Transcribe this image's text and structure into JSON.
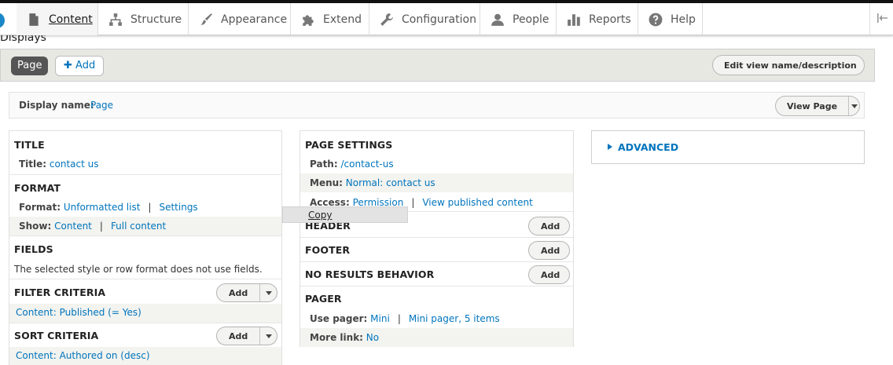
{
  "toolbar": {
    "items": [
      {
        "label": "Content",
        "icon": "file-icon",
        "active": true
      },
      {
        "label": "Structure",
        "icon": "sitemap-icon"
      },
      {
        "label": "Appearance",
        "icon": "paintbrush-icon"
      },
      {
        "label": "Extend",
        "icon": "puzzle-icon"
      },
      {
        "label": "Configuration",
        "icon": "wrench-icon"
      },
      {
        "label": "People",
        "icon": "person-icon"
      },
      {
        "label": "Reports",
        "icon": "bar-chart-icon"
      },
      {
        "label": "Help",
        "icon": "question-icon"
      }
    ]
  },
  "page": {
    "displays_title": "Displays"
  },
  "display_tabs": {
    "page_tab": "Page",
    "add_label": "Add",
    "edit_view_label": "Edit view name/description"
  },
  "display_name": {
    "label": "Display name:",
    "value": "Page",
    "view_page_label": "View Page"
  },
  "left": {
    "title_heading": "TITLE",
    "title_label": "Title:",
    "title_value": "contact us",
    "format_heading": "FORMAT",
    "format_label": "Format:",
    "format_value": "Unformatted list",
    "format_settings": "Settings",
    "show_label": "Show:",
    "show_value": "Content",
    "show_settings": "Full content",
    "fields_heading": "FIELDS",
    "fields_text": "The selected style or row format does not use fields.",
    "filter_heading": "FILTER CRITERIA",
    "filter_value": "Content: Published (= Yes)",
    "sort_heading": "SORT CRITERIA",
    "sort_value": "Content: Authored on (desc)",
    "add_label": "Add"
  },
  "middle": {
    "page_settings_heading": "PAGE SETTINGS",
    "path_label": "Path:",
    "path_value": "/contact-us",
    "menu_label": "Menu:",
    "menu_value": "Normal: contact us",
    "access_label": "Access:",
    "access_value": "Permission",
    "access_settings": "View published content",
    "header_heading": "HEADER",
    "footer_heading": "FOOTER",
    "no_results_heading": "NO RESULTS BEHAVIOR",
    "pager_heading": "PAGER",
    "use_pager_label": "Use pager:",
    "use_pager_value": "Mini",
    "use_pager_settings": "Mini pager, 5 items",
    "more_link_label": "More link:",
    "more_link_value": "No",
    "add_label": "Add"
  },
  "advanced": {
    "label": "ADVANCED"
  },
  "context_menu": {
    "copy": "Copy"
  },
  "colors": {
    "link": "#0074bd",
    "tab_active_bg": "#555555",
    "tabs_bar_bg": "#e8e8e3"
  }
}
